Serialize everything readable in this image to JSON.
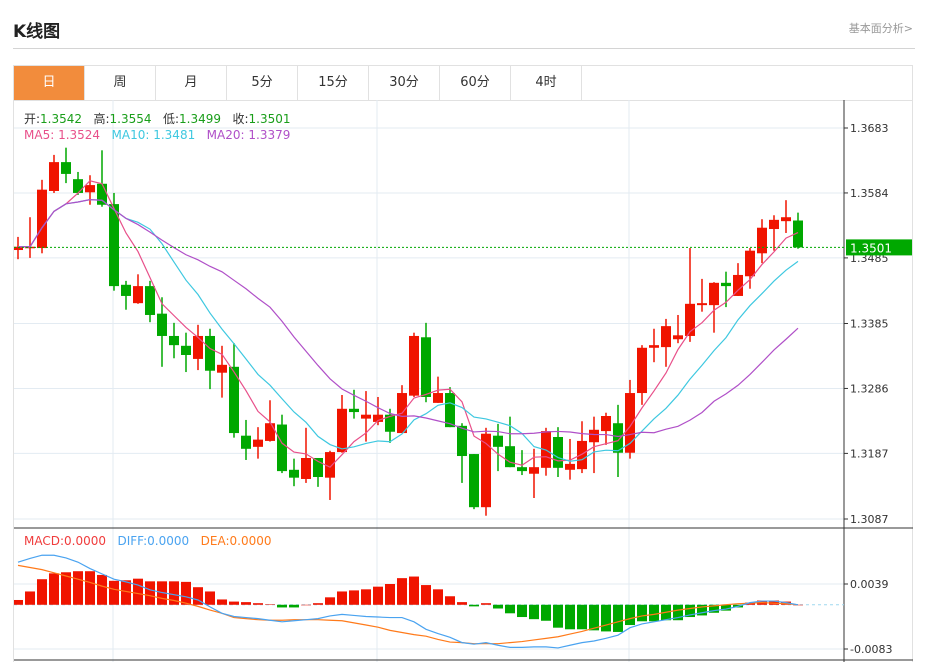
{
  "header": {
    "title": "K线图",
    "link": "基本面分析>"
  },
  "tabs": [
    {
      "label": "日",
      "active": true
    },
    {
      "label": "周"
    },
    {
      "label": "月"
    },
    {
      "label": "5分"
    },
    {
      "label": "15分"
    },
    {
      "label": "30分"
    },
    {
      "label": "60分"
    },
    {
      "label": "4时"
    }
  ],
  "ohlc_info": {
    "open_label": "开:",
    "open": "1.3542",
    "high_label": "高:",
    "high": "1.3554",
    "low_label": "低:",
    "low": "1.3499",
    "close_label": "收:",
    "close": "1.3501"
  },
  "ma_info": {
    "ma5_label": "MA5: ",
    "ma5": "1.3524",
    "ma10_label": "MA10: ",
    "ma10": "1.3481",
    "ma20_label": "MA20: ",
    "ma20": "1.3379"
  },
  "macd_info": {
    "macd_label": "MACD:",
    "macd": "0.0000",
    "diff_label": "DIFF:",
    "diff": "0.0000",
    "dea_label": "DEA:",
    "dea": "0.0000"
  },
  "colors": {
    "up": "#f01400",
    "down": "#00a800",
    "ma5": "#e8508a",
    "ma10": "#3ec8e0",
    "ma20": "#b050c8",
    "diff": "#4aa3f0",
    "dea": "#ff7a1a",
    "accent": "#f28c3c"
  },
  "chart_data": {
    "type": "candlestick",
    "price_ticks": [
      "1.3683",
      "1.3584",
      "1.3485",
      "1.3385",
      "1.3286",
      "1.3187",
      "1.3087"
    ],
    "price_range": [
      1.3087,
      1.3683
    ],
    "current_price": "1.3501",
    "candles": [
      [
        1.3497,
        1.3517,
        1.3483,
        1.3502
      ],
      [
        1.35,
        1.3547,
        1.3485,
        1.3502
      ],
      [
        1.35,
        1.3604,
        1.3492,
        1.3589
      ],
      [
        1.3587,
        1.3642,
        1.3584,
        1.3631
      ],
      [
        1.3631,
        1.3653,
        1.3599,
        1.3613
      ],
      [
        1.3605,
        1.3616,
        1.3581,
        1.3584
      ],
      [
        1.3585,
        1.3611,
        1.3566,
        1.3596
      ],
      [
        1.3598,
        1.3649,
        1.3563,
        1.3566
      ],
      [
        1.3567,
        1.3584,
        1.3435,
        1.3442
      ],
      [
        1.3444,
        1.345,
        1.3406,
        1.3427
      ],
      [
        1.3416,
        1.346,
        1.3415,
        1.3442
      ],
      [
        1.3442,
        1.345,
        1.3387,
        1.3398
      ],
      [
        1.34,
        1.3425,
        1.3319,
        1.3366
      ],
      [
        1.3366,
        1.3386,
        1.3332,
        1.3352
      ],
      [
        1.3351,
        1.3371,
        1.3311,
        1.3337
      ],
      [
        1.3331,
        1.3383,
        1.3314,
        1.3366
      ],
      [
        1.3366,
        1.3377,
        1.3285,
        1.3313
      ],
      [
        1.331,
        1.3351,
        1.3272,
        1.3322
      ],
      [
        1.3319,
        1.3355,
        1.3211,
        1.3218
      ],
      [
        1.3214,
        1.3238,
        1.3177,
        1.3194
      ],
      [
        1.3197,
        1.3227,
        1.3179,
        1.3208
      ],
      [
        1.3206,
        1.3268,
        1.3205,
        1.3233
      ],
      [
        1.3231,
        1.3246,
        1.3157,
        1.316
      ],
      [
        1.3162,
        1.3179,
        1.3137,
        1.315
      ],
      [
        1.3148,
        1.3226,
        1.3142,
        1.318
      ],
      [
        1.318,
        1.318,
        1.3136,
        1.3151
      ],
      [
        1.315,
        1.3191,
        1.3116,
        1.3189
      ],
      [
        1.3189,
        1.3276,
        1.3188,
        1.3255
      ],
      [
        1.3255,
        1.3284,
        1.324,
        1.325
      ],
      [
        1.324,
        1.3282,
        1.3205,
        1.3246
      ],
      [
        1.3235,
        1.3273,
        1.323,
        1.3246
      ],
      [
        1.3246,
        1.3255,
        1.3203,
        1.322
      ],
      [
        1.3218,
        1.3291,
        1.3218,
        1.3279
      ],
      [
        1.3275,
        1.3371,
        1.3273,
        1.3366
      ],
      [
        1.3364,
        1.3386,
        1.3265,
        1.3273
      ],
      [
        1.3264,
        1.3304,
        1.3264,
        1.3279
      ],
      [
        1.3279,
        1.3288,
        1.3227,
        1.3227
      ],
      [
        1.3229,
        1.3233,
        1.3142,
        1.3183
      ],
      [
        1.3186,
        1.3186,
        1.3102,
        1.3105
      ],
      [
        1.3105,
        1.3226,
        1.3092,
        1.3217
      ],
      [
        1.3214,
        1.3232,
        1.316,
        1.3197
      ],
      [
        1.3198,
        1.3243,
        1.3166,
        1.3166
      ],
      [
        1.3166,
        1.3192,
        1.3154,
        1.316
      ],
      [
        1.3156,
        1.3194,
        1.3119,
        1.3166
      ],
      [
        1.3165,
        1.3226,
        1.3153,
        1.3221
      ],
      [
        1.3212,
        1.3227,
        1.3151,
        1.3165
      ],
      [
        1.3162,
        1.3209,
        1.3147,
        1.3171
      ],
      [
        1.3163,
        1.3236,
        1.3157,
        1.3206
      ],
      [
        1.3204,
        1.3243,
        1.3157,
        1.3223
      ],
      [
        1.3221,
        1.3249,
        1.32,
        1.3244
      ],
      [
        1.3233,
        1.3261,
        1.3151,
        1.3188
      ],
      [
        1.3188,
        1.3299,
        1.3179,
        1.3279
      ],
      [
        1.3279,
        1.3352,
        1.3261,
        1.3348
      ],
      [
        1.3348,
        1.3377,
        1.3326,
        1.3352
      ],
      [
        1.3349,
        1.3392,
        1.3319,
        1.3381
      ],
      [
        1.3361,
        1.3398,
        1.3355,
        1.3367
      ],
      [
        1.3366,
        1.35,
        1.3357,
        1.3415
      ],
      [
        1.3413,
        1.3453,
        1.3403,
        1.3416
      ],
      [
        1.3413,
        1.3448,
        1.3371,
        1.3447
      ],
      [
        1.3447,
        1.3464,
        1.341,
        1.3442
      ],
      [
        1.3427,
        1.3477,
        1.3427,
        1.3459
      ],
      [
        1.3457,
        1.35,
        1.3438,
        1.3496
      ],
      [
        1.3492,
        1.3544,
        1.3477,
        1.3531
      ],
      [
        1.3529,
        1.355,
        1.3496,
        1.3543
      ],
      [
        1.3541,
        1.3573,
        1.3523,
        1.3547
      ],
      [
        1.3542,
        1.3554,
        1.3499,
        1.3501
      ]
    ],
    "macd_ticks": [
      "0.0039",
      "-0.0083"
    ],
    "macd_range": [
      -0.0083,
      0.0039
    ],
    "macd_hist": [
      0.0009,
      0.0025,
      0.0048,
      0.0059,
      0.0061,
      0.0063,
      0.0063,
      0.0056,
      0.0045,
      0.0046,
      0.0049,
      0.0044,
      0.0044,
      0.0044,
      0.0043,
      0.0033,
      0.0025,
      0.001,
      0.0006,
      0.0005,
      0.0003,
      0.0001,
      -0.0005,
      -0.0005,
      0.0,
      0.0003,
      0.0014,
      0.0025,
      0.0027,
      0.0029,
      0.0034,
      0.0039,
      0.005,
      0.0053,
      0.0037,
      0.0029,
      0.0016,
      0.0005,
      -0.0003,
      0.0003,
      -0.0007,
      -0.0016,
      -0.0023,
      -0.0027,
      -0.003,
      -0.0043,
      -0.0046,
      -0.0046,
      -0.0048,
      -0.005,
      -0.0051,
      -0.0038,
      -0.0031,
      -0.0031,
      -0.0029,
      -0.0029,
      -0.0023,
      -0.002,
      -0.0015,
      -0.0011,
      -0.0005,
      0.0004,
      0.0008,
      0.0008,
      0.0006,
      0.0
    ],
    "diff": [
      0.008,
      0.0087,
      0.0093,
      0.0093,
      0.0088,
      0.008,
      0.0068,
      0.0058,
      0.0048,
      0.0043,
      0.0037,
      0.0028,
      0.0023,
      0.0019,
      0.0015,
      0.0009,
      -0.0004,
      -0.0016,
      -0.0022,
      -0.0024,
      -0.0026,
      -0.0029,
      -0.0032,
      -0.003,
      -0.0028,
      -0.0026,
      -0.0021,
      -0.0018,
      -0.002,
      -0.0022,
      -0.0023,
      -0.0024,
      -0.0024,
      -0.0032,
      -0.0046,
      -0.0054,
      -0.0061,
      -0.0071,
      -0.0074,
      -0.0071,
      -0.0076,
      -0.008,
      -0.008,
      -0.0079,
      -0.0079,
      -0.0081,
      -0.0076,
      -0.0071,
      -0.0068,
      -0.0063,
      -0.0057,
      -0.0043,
      -0.0036,
      -0.0032,
      -0.0028,
      -0.0024,
      -0.0019,
      -0.0015,
      -0.0011,
      -0.0008,
      -0.0003,
      0.0004,
      0.0007,
      0.0007,
      0.0004,
      0.0
    ],
    "dea": [
      0.0074,
      0.007,
      0.0066,
      0.006,
      0.0054,
      0.0048,
      0.0042,
      0.0035,
      0.0029,
      0.0025,
      0.0021,
      0.0017,
      0.0012,
      0.0008,
      0.0003,
      -0.0003,
      -0.001,
      -0.0016,
      -0.0024,
      -0.0026,
      -0.0028,
      -0.0029,
      -0.0029,
      -0.0028,
      -0.0028,
      -0.0028,
      -0.0029,
      -0.003,
      -0.0034,
      -0.0038,
      -0.0042,
      -0.0048,
      -0.0052,
      -0.0056,
      -0.0059,
      -0.0065,
      -0.007,
      -0.0071,
      -0.0073,
      -0.0073,
      -0.0073,
      -0.0071,
      -0.0069,
      -0.0066,
      -0.0063,
      -0.006,
      -0.0055,
      -0.005,
      -0.0044,
      -0.0038,
      -0.0032,
      -0.0026,
      -0.0021,
      -0.0018,
      -0.0014,
      -0.001,
      -0.0007,
      -0.0004,
      -0.0002,
      0.0,
      0.0002,
      0.0003,
      0.0004,
      0.0003,
      0.0002,
      0.0
    ]
  }
}
